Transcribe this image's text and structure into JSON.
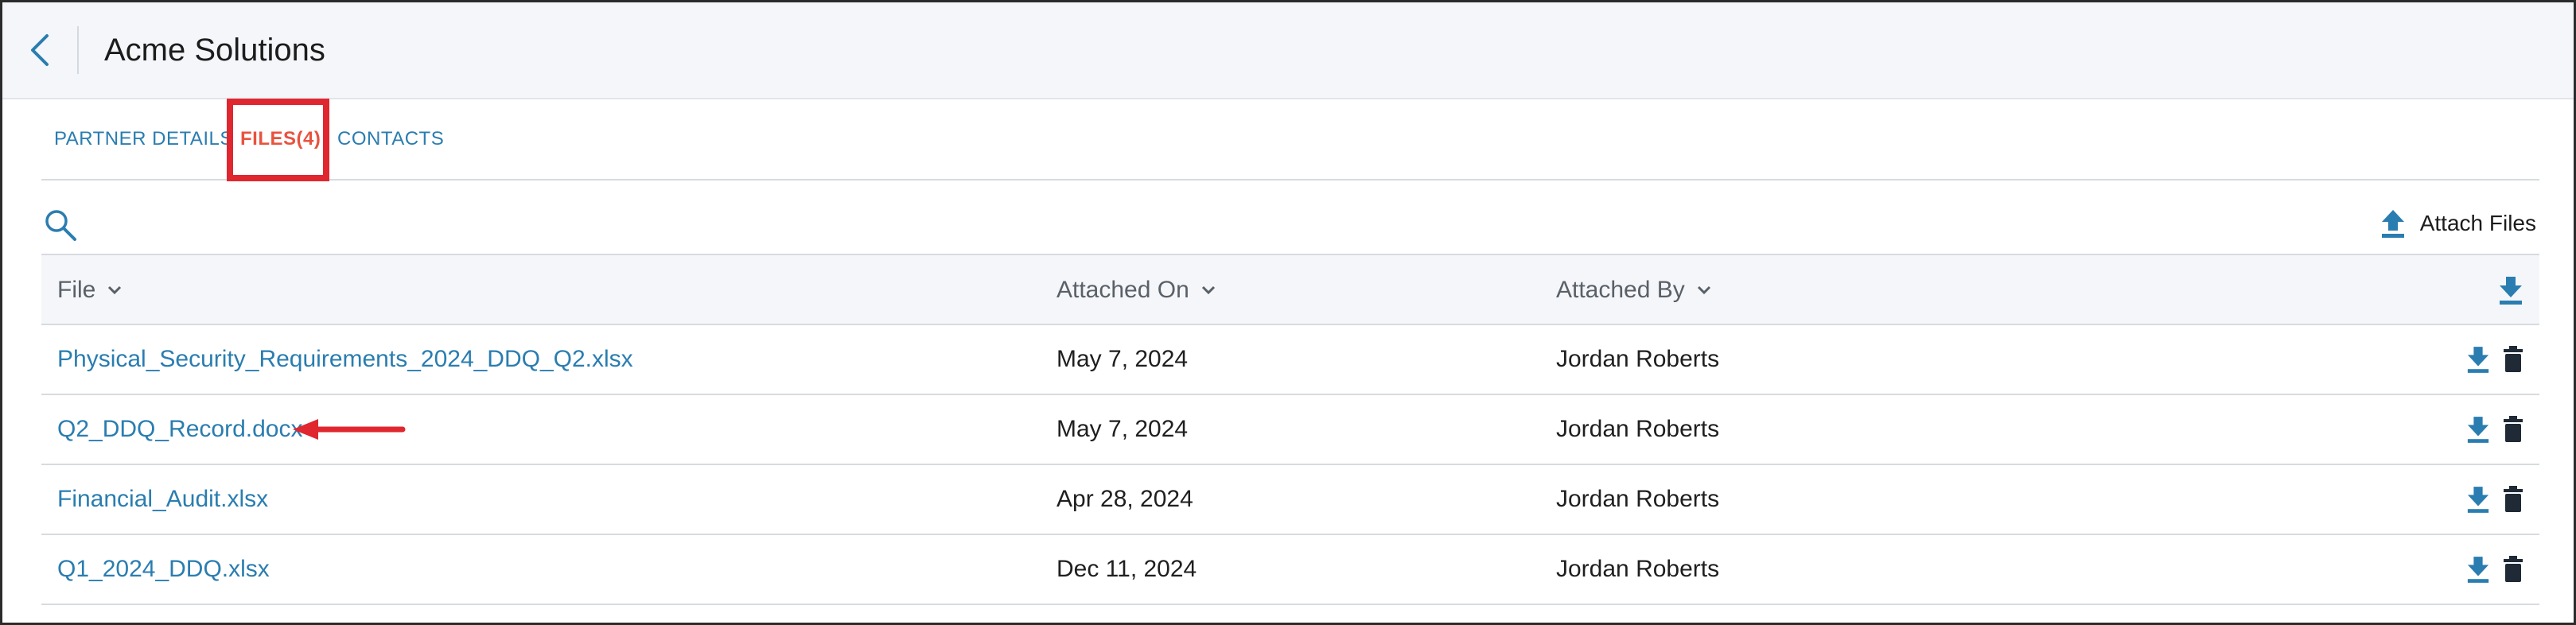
{
  "header": {
    "title": "Acme Solutions"
  },
  "tabs": [
    {
      "label": "PARTNER DETAILS"
    },
    {
      "label": "FILES(4)"
    },
    {
      "label": "CONTACTS"
    }
  ],
  "toolbar": {
    "attach_label": "Attach Files"
  },
  "table": {
    "columns": [
      {
        "label": "File"
      },
      {
        "label": "Attached On"
      },
      {
        "label": "Attached By"
      }
    ],
    "rows": [
      {
        "file": "Physical_Security_Requirements_2024_DDQ_Q2.xlsx",
        "attached_on": "May 7, 2024",
        "attached_by": "Jordan Roberts"
      },
      {
        "file": "Q2_DDQ_Record.docx",
        "attached_on": "May 7, 2024",
        "attached_by": "Jordan Roberts"
      },
      {
        "file": "Financial_Audit.xlsx",
        "attached_on": "Apr 28, 2024",
        "attached_by": "Jordan Roberts"
      },
      {
        "file": "Q1_2024_DDQ.xlsx",
        "attached_on": "Dec 11, 2024",
        "attached_by": "Jordan Roberts"
      }
    ]
  },
  "colors": {
    "link": "#2a7db0",
    "active_tab": "#e8523f",
    "highlight": "#e0262e",
    "icon": "#2a7db0",
    "delete": "#1f2a36"
  }
}
